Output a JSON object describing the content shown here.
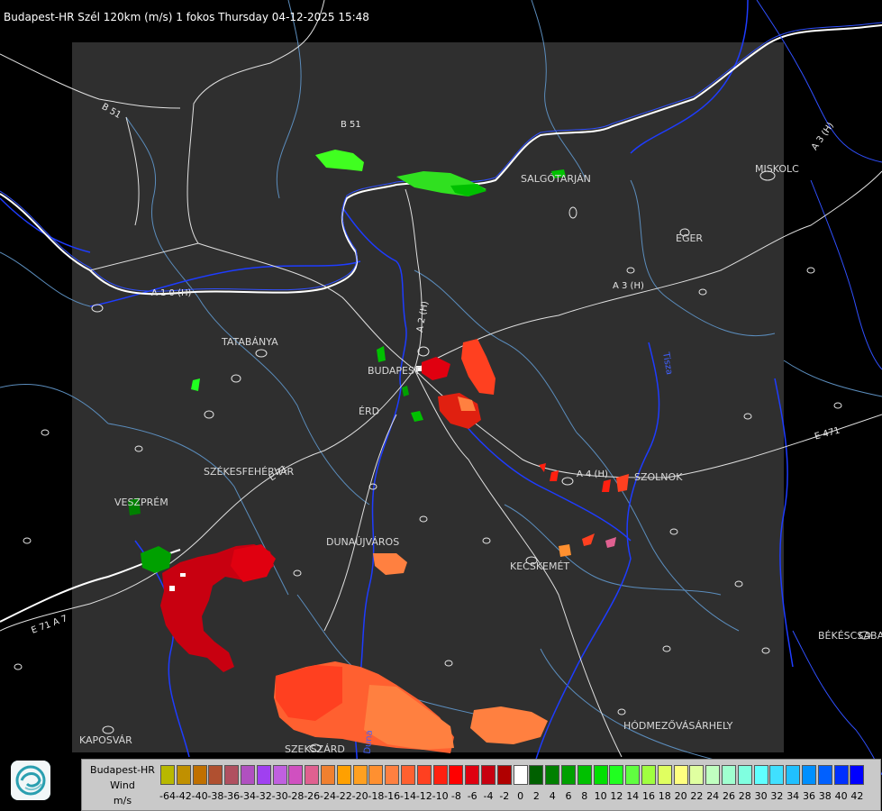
{
  "header": {
    "title": "Budapest-HR Szél 120km (m/s) 1 fokos Thursday 04-12-2025 15:48"
  },
  "cities": [
    {
      "name": "SALGÓTARJÁN"
    },
    {
      "name": "MISKOLC"
    },
    {
      "name": "EGER"
    },
    {
      "name": "TATABÁNYA"
    },
    {
      "name": "BUDAPEST"
    },
    {
      "name": "ÉRD"
    },
    {
      "name": "SZOLNOK"
    },
    {
      "name": "SZÉKESFEHÉRVÁR"
    },
    {
      "name": "VESZPRÉM"
    },
    {
      "name": "DUNAÚJVÁROS"
    },
    {
      "name": "KECSKEMÉT"
    },
    {
      "name": "BÉKÉSCSABA"
    },
    {
      "name": "HÓDMEZŐVÁSÁRHELY"
    },
    {
      "name": "KAPOSVÁR"
    },
    {
      "name": "SZEKSZÁRD"
    }
  ],
  "roads": [
    {
      "name": "B 51"
    },
    {
      "name": "B 51"
    },
    {
      "name": "A 3 (H)"
    },
    {
      "name": "A 3 (H)"
    },
    {
      "name": "A 1 0 (H)"
    },
    {
      "name": "A 2 (H)"
    },
    {
      "name": "A 4 (H)"
    },
    {
      "name": "E 471"
    },
    {
      "name": "E 71"
    },
    {
      "name": "E 71 A 7"
    },
    {
      "name": "Duna"
    },
    {
      "name": "Tisza"
    }
  ],
  "legend": {
    "title": "Budapest-HR",
    "product": "Wind",
    "unit": "m/s",
    "bins": [
      {
        "label": "-64",
        "color": "#b8b800"
      },
      {
        "label": "-42",
        "color": "#c09000"
      },
      {
        "label": "-40",
        "color": "#c07000"
      },
      {
        "label": "-38",
        "color": "#b05030"
      },
      {
        "label": "-36",
        "color": "#b05060"
      },
      {
        "label": "-34",
        "color": "#b050c0"
      },
      {
        "label": "-32",
        "color": "#a040f0"
      },
      {
        "label": "-30",
        "color": "#c060e0"
      },
      {
        "label": "-28",
        "color": "#d050c0"
      },
      {
        "label": "-26",
        "color": "#e06090"
      },
      {
        "label": "-24",
        "color": "#f08030"
      },
      {
        "label": "-22",
        "color": "#ffa000"
      },
      {
        "label": "-20",
        "color": "#ffa020"
      },
      {
        "label": "-18",
        "color": "#ff9030"
      },
      {
        "label": "-16",
        "color": "#ff8040"
      },
      {
        "label": "-14",
        "color": "#ff6030"
      },
      {
        "label": "-12",
        "color": "#ff4020"
      },
      {
        "label": "-10",
        "color": "#ff2010"
      },
      {
        "label": "-8",
        "color": "#ff0000"
      },
      {
        "label": "-6",
        "color": "#e00010"
      },
      {
        "label": "-4",
        "color": "#c80010"
      },
      {
        "label": "-2",
        "color": "#b00000"
      },
      {
        "label": "0",
        "color": "#ffffff"
      },
      {
        "label": "2",
        "color": "#006000"
      },
      {
        "label": "4",
        "color": "#008000"
      },
      {
        "label": "6",
        "color": "#00a000"
      },
      {
        "label": "8",
        "color": "#00c000"
      },
      {
        "label": "10",
        "color": "#00e000"
      },
      {
        "label": "12",
        "color": "#20ff20"
      },
      {
        "label": "14",
        "color": "#60ff40"
      },
      {
        "label": "16",
        "color": "#a0ff40"
      },
      {
        "label": "18",
        "color": "#e0ff60"
      },
      {
        "label": "20",
        "color": "#ffff80"
      },
      {
        "label": "22",
        "color": "#e0ffa0"
      },
      {
        "label": "24",
        "color": "#c0ffc0"
      },
      {
        "label": "26",
        "color": "#a0ffd0"
      },
      {
        "label": "28",
        "color": "#80ffe0"
      },
      {
        "label": "30",
        "color": "#60ffff"
      },
      {
        "label": "32",
        "color": "#40e0ff"
      },
      {
        "label": "34",
        "color": "#20c0ff"
      },
      {
        "label": "36",
        "color": "#0090ff"
      },
      {
        "label": "38",
        "color": "#0060ff"
      },
      {
        "label": "40",
        "color": "#0030ff"
      },
      {
        "label": "42",
        "color": "#0000ff"
      }
    ]
  },
  "colors": {
    "background": "#000000",
    "radar_area": "#2f2f2f",
    "roads": "#ffffff",
    "rivers": "#2040ff",
    "borders": "#4f7fb0"
  },
  "icons": {
    "logo": "omsz-logo-icon"
  }
}
